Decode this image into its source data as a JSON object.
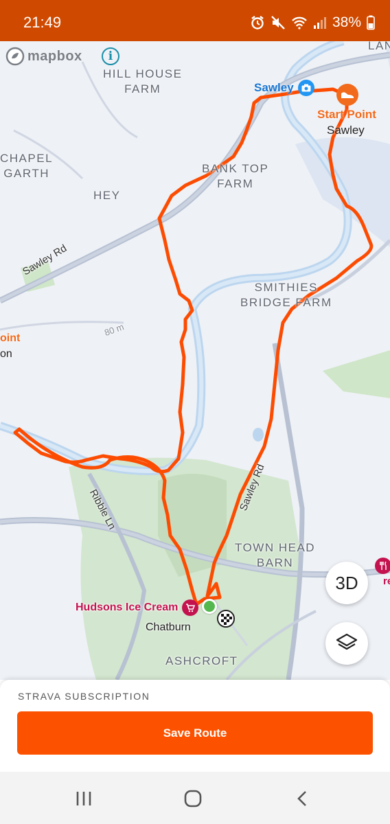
{
  "status_bar": {
    "time": "21:49",
    "battery": "38%",
    "icons": [
      "alarm-icon",
      "mute-icon",
      "wifi-icon",
      "signal-icon",
      "battery-icon"
    ]
  },
  "map": {
    "attribution": "mapbox",
    "labels": {
      "hill_house_farm": "HILL HOUSE\nFARM",
      "chapel_garth": "CHAPEL\nGARTH",
      "hey": "HEY",
      "bank_top_farm": "BANK TOP\nFARM",
      "smithies_bridge_farm": "SMITHIES\nBRIDGE FARM",
      "town_head_barn": "TOWN HEAD\nBARN",
      "ashcroft": "ASHCROFT",
      "lan": "LAN"
    },
    "roads": {
      "sawley_rd_left": "Sawley Rd",
      "sawley_rd_right": "Sawley Rd",
      "ribble_ln": "Ribble Ln",
      "contour": "80 m"
    },
    "places": {
      "sawley_poi": "Sawley",
      "start_point": "Start Point",
      "start_point_sub": "Sawley",
      "left_point": "oint",
      "left_point_sub": "on",
      "hudsons": "Hudsons Ice Cream",
      "chatburn": "Chatburn",
      "right_poi": "reen"
    },
    "route_color": "#fc4c02",
    "button_3d": "3D"
  },
  "sheet": {
    "subscription_label": "STRAVA SUBSCRIPTION",
    "save_label": "Save Route"
  },
  "colors": {
    "status_bar": "#cf4a00",
    "accent": "#fc5200",
    "poi_red": "#c4124f",
    "poi_blue": "#1976d2"
  }
}
